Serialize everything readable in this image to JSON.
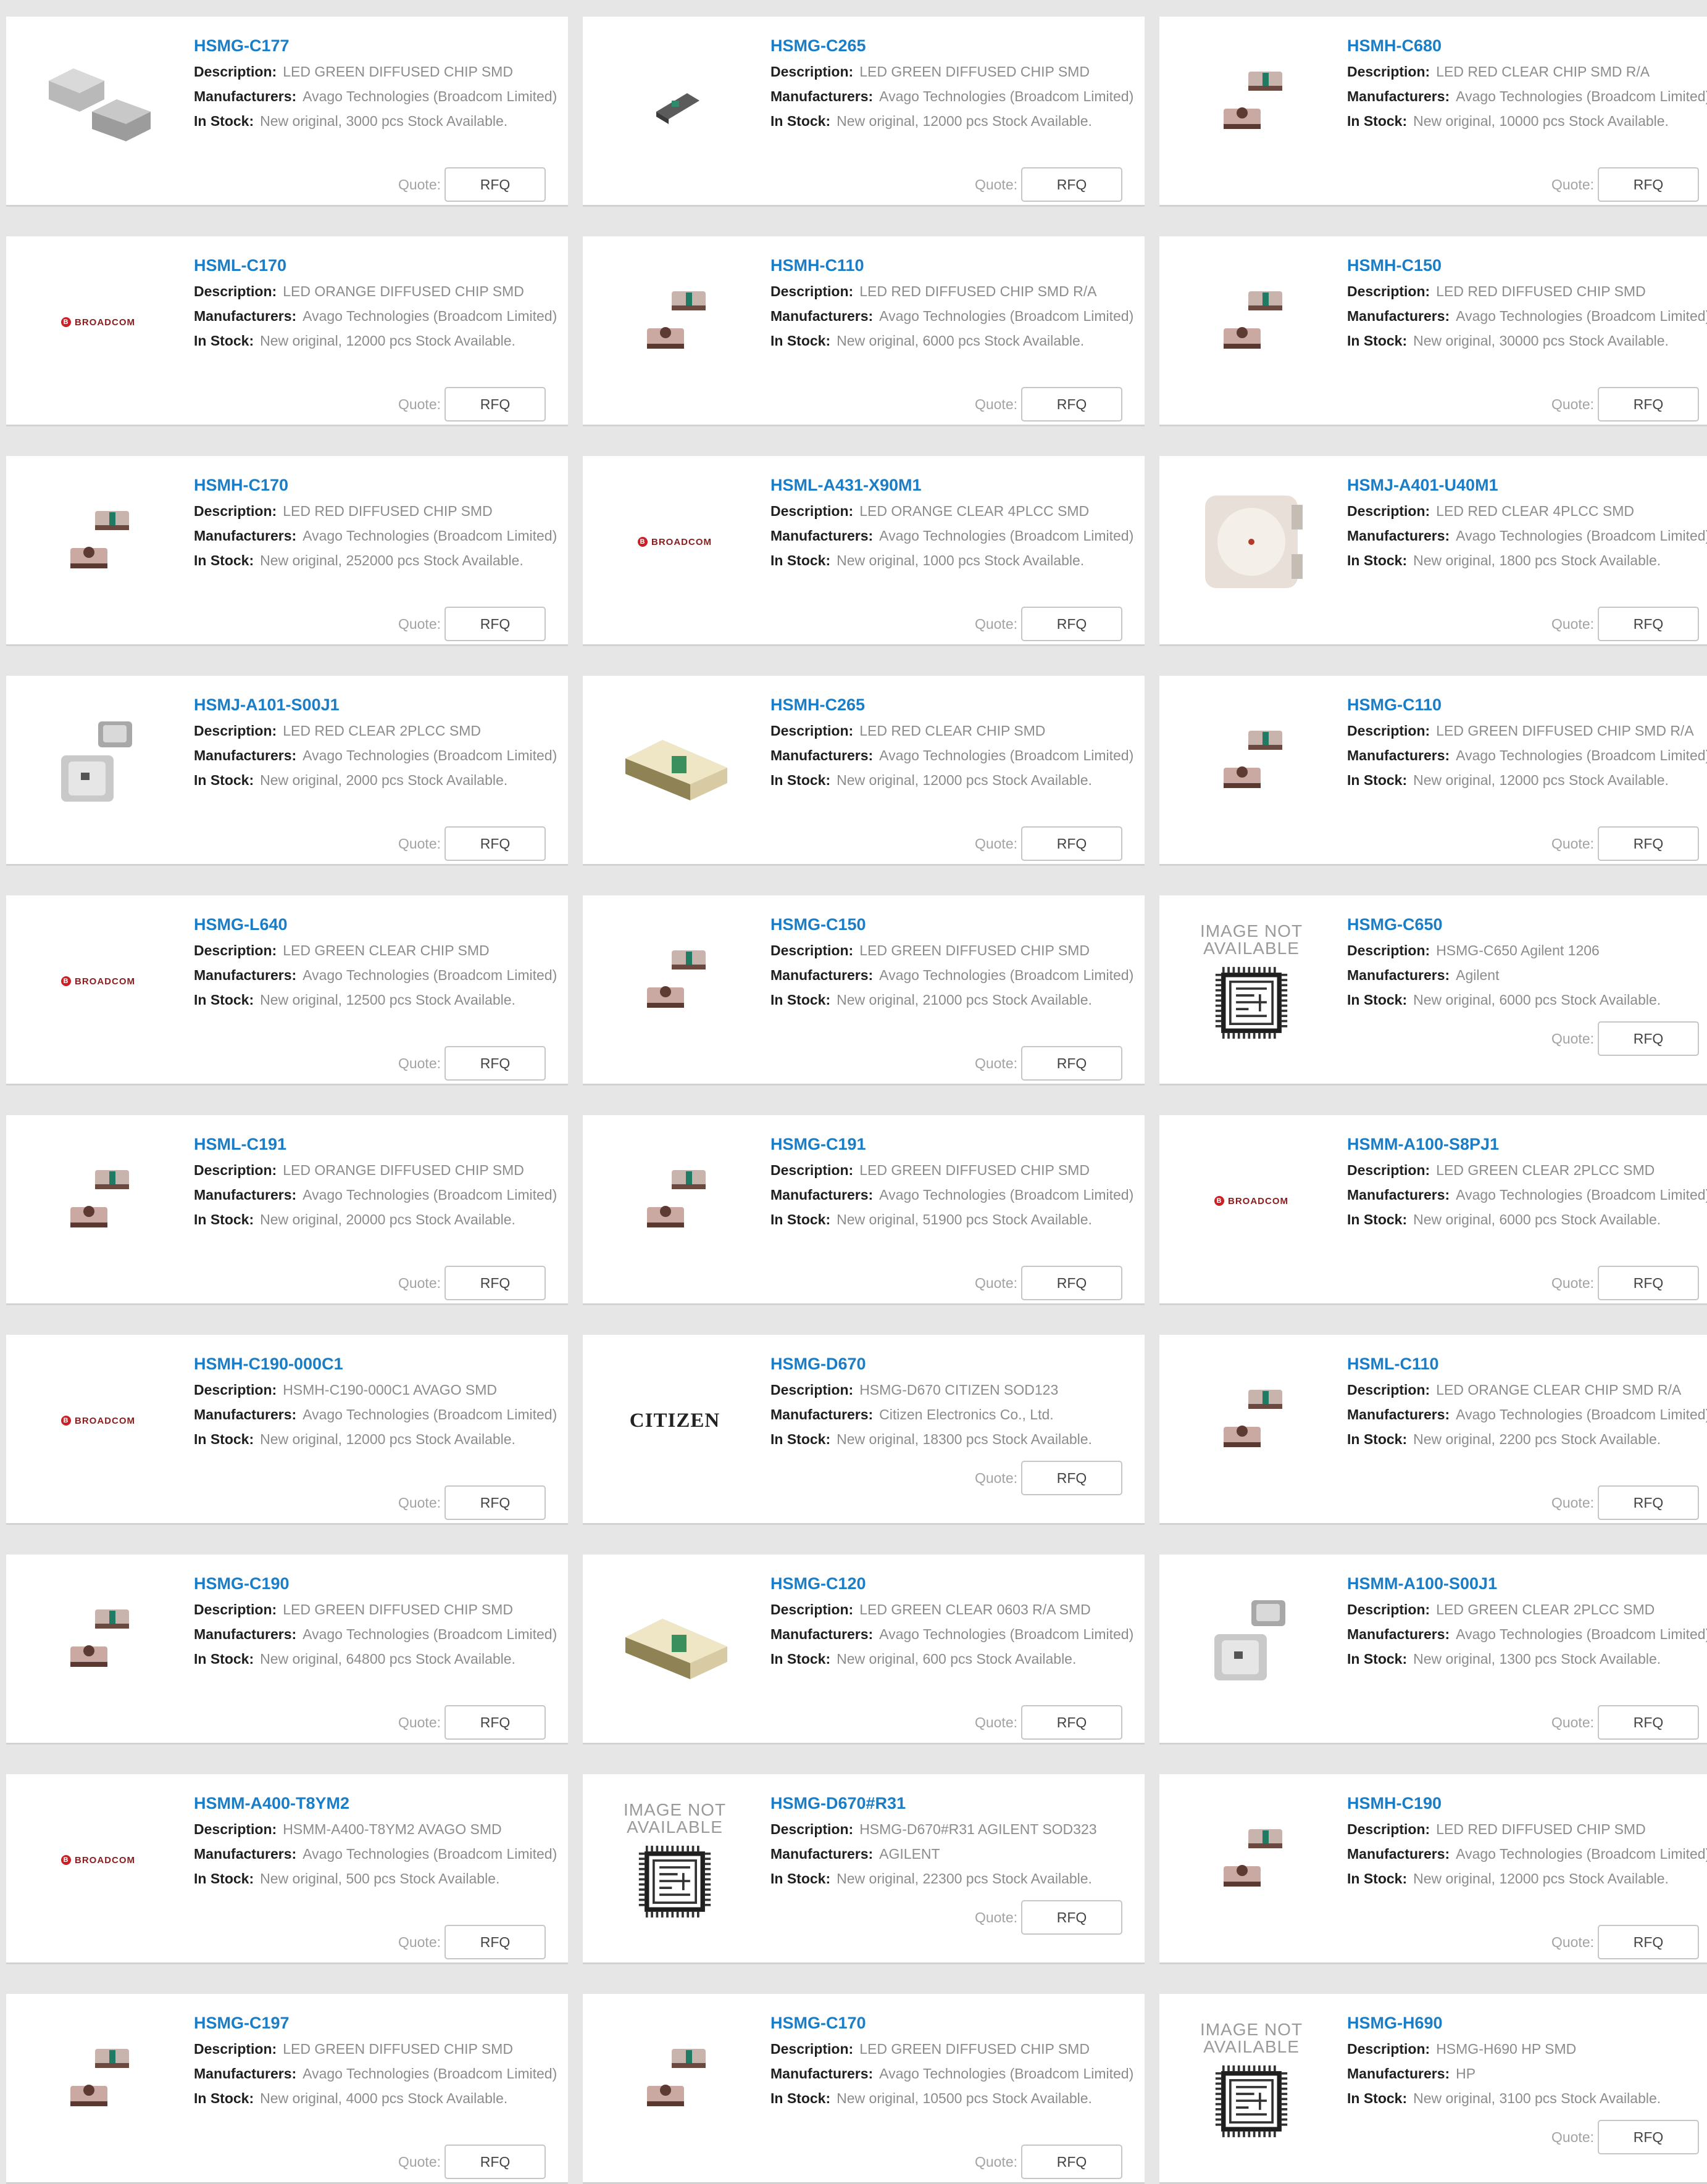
{
  "labels": {
    "description": "Description:",
    "manufacturers": "Manufacturers:",
    "in_stock": "In Stock:",
    "quote": "Quote:",
    "rfq": "RFQ"
  },
  "colors": {
    "link": "#1a7dc6",
    "page_background": "#e6e6e6"
  },
  "products": [
    {
      "part": "HSMG-C177",
      "description": "LED GREEN DIFFUSED CHIP SMD",
      "manufacturer": "Avago Technologies (Broadcom Limited)",
      "stock": "New original, 3000 pcs Stock Available.",
      "image": "chip-pair-gray-icon"
    },
    {
      "part": "HSMG-C265",
      "description": "LED GREEN DIFFUSED CHIP SMD",
      "manufacturer": "Avago Technologies (Broadcom Limited)",
      "stock": "New original, 12000 pcs Stock Available.",
      "image": "led-chip-small-icon"
    },
    {
      "part": "HSMH-C680",
      "description": "LED RED CLEAR CHIP SMD R/A",
      "manufacturer": "Avago Technologies (Broadcom Limited)",
      "stock": "New original, 10000 pcs Stock Available.",
      "image": "led-chip-pair-icon"
    },
    {
      "part": "HSML-C170",
      "description": "LED ORANGE DIFFUSED CHIP SMD",
      "manufacturer": "Avago Technologies (Broadcom Limited)",
      "stock": "New original, 12000 pcs Stock Available.",
      "image": "broadcom-logo",
      "logo_text": "BROADCOM"
    },
    {
      "part": "HSMH-C110",
      "description": "LED RED DIFFUSED CHIP SMD R/A",
      "manufacturer": "Avago Technologies (Broadcom Limited)",
      "stock": "New original, 6000 pcs Stock Available.",
      "image": "led-chip-pair-icon"
    },
    {
      "part": "HSMH-C150",
      "description": "LED RED DIFFUSED CHIP SMD",
      "manufacturer": "Avago Technologies (Broadcom Limited)",
      "stock": "New original, 30000 pcs Stock Available.",
      "image": "led-chip-pair-icon"
    },
    {
      "part": "HSMH-C170",
      "description": "LED RED DIFFUSED CHIP SMD",
      "manufacturer": "Avago Technologies (Broadcom Limited)",
      "stock": "New original, 252000 pcs Stock Available.",
      "image": "led-chip-pair-icon"
    },
    {
      "part": "HSML-A431-X90M1",
      "description": "LED ORANGE CLEAR 4PLCC SMD",
      "manufacturer": "Avago Technologies (Broadcom Limited)",
      "stock": "New original, 1000 pcs Stock Available.",
      "image": "broadcom-logo",
      "logo_text": "BROADCOM"
    },
    {
      "part": "HSMJ-A401-U40M1",
      "description": "LED RED CLEAR 4PLCC SMD",
      "manufacturer": "Avago Technologies (Broadcom Limited)",
      "stock": "New original, 1800 pcs Stock Available.",
      "image": "plcc-package-icon"
    },
    {
      "part": "HSMJ-A101-S00J1",
      "description": "LED RED CLEAR 2PLCC SMD",
      "manufacturer": "Avago Technologies (Broadcom Limited)",
      "stock": "New original, 2000 pcs Stock Available.",
      "image": "plcc-pair-icon"
    },
    {
      "part": "HSMH-C265",
      "description": "LED RED CLEAR CHIP SMD",
      "manufacturer": "Avago Technologies (Broadcom Limited)",
      "stock": "New original, 12000 pcs Stock Available.",
      "image": "led-chip-large-icon"
    },
    {
      "part": "HSMG-C110",
      "description": "LED GREEN DIFFUSED CHIP SMD R/A",
      "manufacturer": "Avago Technologies (Broadcom Limited)",
      "stock": "New original, 12000 pcs Stock Available.",
      "image": "led-chip-pair-icon"
    },
    {
      "part": "HSMG-L640",
      "description": "LED GREEN CLEAR CHIP SMD",
      "manufacturer": "Avago Technologies (Broadcom Limited)",
      "stock": "New original, 12500 pcs Stock Available.",
      "image": "broadcom-logo",
      "logo_text": "BROADCOM"
    },
    {
      "part": "HSMG-C150",
      "description": "LED GREEN DIFFUSED CHIP SMD",
      "manufacturer": "Avago Technologies (Broadcom Limited)",
      "stock": "New original, 21000 pcs Stock Available.",
      "image": "led-chip-pair-icon"
    },
    {
      "part": "HSMG-C650",
      "description": "HSMG-C650 Agilent 1206",
      "manufacturer": "Agilent",
      "stock": "New original, 6000 pcs Stock Available.",
      "image": "image-not-available",
      "na_text": "IMAGE NOT AVAILABLE"
    },
    {
      "part": "HSML-C191",
      "description": "LED ORANGE DIFFUSED CHIP SMD",
      "manufacturer": "Avago Technologies (Broadcom Limited)",
      "stock": "New original, 20000 pcs Stock Available.",
      "image": "led-chip-pair-icon"
    },
    {
      "part": "HSMG-C191",
      "description": "LED GREEN DIFFUSED CHIP SMD",
      "manufacturer": "Avago Technologies (Broadcom Limited)",
      "stock": "New original, 51900 pcs Stock Available.",
      "image": "led-chip-pair-icon"
    },
    {
      "part": "HSMM-A100-S8PJ1",
      "description": "LED GREEN CLEAR 2PLCC SMD",
      "manufacturer": "Avago Technologies (Broadcom Limited)",
      "stock": "New original, 6000 pcs Stock Available.",
      "image": "broadcom-logo",
      "logo_text": "BROADCOM"
    },
    {
      "part": "HSMH-C190-000C1",
      "description": "HSMH-C190-000C1 AVAGO SMD",
      "manufacturer": "Avago Technologies (Broadcom Limited)",
      "stock": "New original, 12000 pcs Stock Available.",
      "image": "broadcom-logo",
      "logo_text": "BROADCOM"
    },
    {
      "part": "HSMG-D670",
      "description": "HSMG-D670 CITIZEN SOD123",
      "manufacturer": "Citizen Electronics Co., Ltd.",
      "stock": "New original, 18300 pcs Stock Available.",
      "image": "citizen-logo",
      "logo_text": "CITIZEN"
    },
    {
      "part": "HSML-C110",
      "description": "LED ORANGE CLEAR CHIP SMD R/A",
      "manufacturer": "Avago Technologies (Broadcom Limited)",
      "stock": "New original, 2200 pcs Stock Available.",
      "image": "led-chip-pair-icon"
    },
    {
      "part": "HSMG-C190",
      "description": "LED GREEN DIFFUSED CHIP SMD",
      "manufacturer": "Avago Technologies (Broadcom Limited)",
      "stock": "New original, 64800 pcs Stock Available.",
      "image": "led-chip-pair-icon"
    },
    {
      "part": "HSMG-C120",
      "description": "LED GREEN CLEAR 0603 R/A SMD",
      "manufacturer": "Avago Technologies (Broadcom Limited)",
      "stock": "New original, 600 pcs Stock Available.",
      "image": "led-chip-large-icon"
    },
    {
      "part": "HSMM-A100-S00J1",
      "description": "LED GREEN CLEAR 2PLCC SMD",
      "manufacturer": "Avago Technologies (Broadcom Limited)",
      "stock": "New original, 1300 pcs Stock Available.",
      "image": "plcc-pair-icon"
    },
    {
      "part": "HSMM-A400-T8YM2",
      "description": "HSMM-A400-T8YM2   AVAGO SMD",
      "manufacturer": "Avago Technologies (Broadcom Limited)",
      "stock": "New original, 500 pcs Stock Available.",
      "image": "broadcom-logo",
      "logo_text": "BROADCOM"
    },
    {
      "part": "HSMG-D670#R31",
      "description": "HSMG-D670#R31 AGILENT SOD323",
      "manufacturer": "AGILENT",
      "stock": "New original, 22300 pcs Stock Available.",
      "image": "image-not-available",
      "na_text": "IMAGE NOT AVAILABLE"
    },
    {
      "part": "HSMH-C190",
      "description": "LED RED DIFFUSED CHIP SMD",
      "manufacturer": "Avago Technologies (Broadcom Limited)",
      "stock": "New original, 12000 pcs Stock Available.",
      "image": "led-chip-pair-icon"
    },
    {
      "part": "HSMG-C197",
      "description": "LED GREEN DIFFUSED CHIP SMD",
      "manufacturer": "Avago Technologies (Broadcom Limited)",
      "stock": "New original, 4000 pcs Stock Available.",
      "image": "led-chip-pair-icon"
    },
    {
      "part": "HSMG-C170",
      "description": "LED GREEN DIFFUSED CHIP SMD",
      "manufacturer": "Avago Technologies (Broadcom Limited)",
      "stock": "New original, 10500 pcs Stock Available.",
      "image": "led-chip-pair-icon"
    },
    {
      "part": "HSMG-H690",
      "description": "HSMG-H690 HP SMD",
      "manufacturer": "HP",
      "stock": "New original, 3100 pcs Stock Available.",
      "image": "image-not-available",
      "na_text": "IMAGE NOT AVAILABLE"
    }
  ]
}
